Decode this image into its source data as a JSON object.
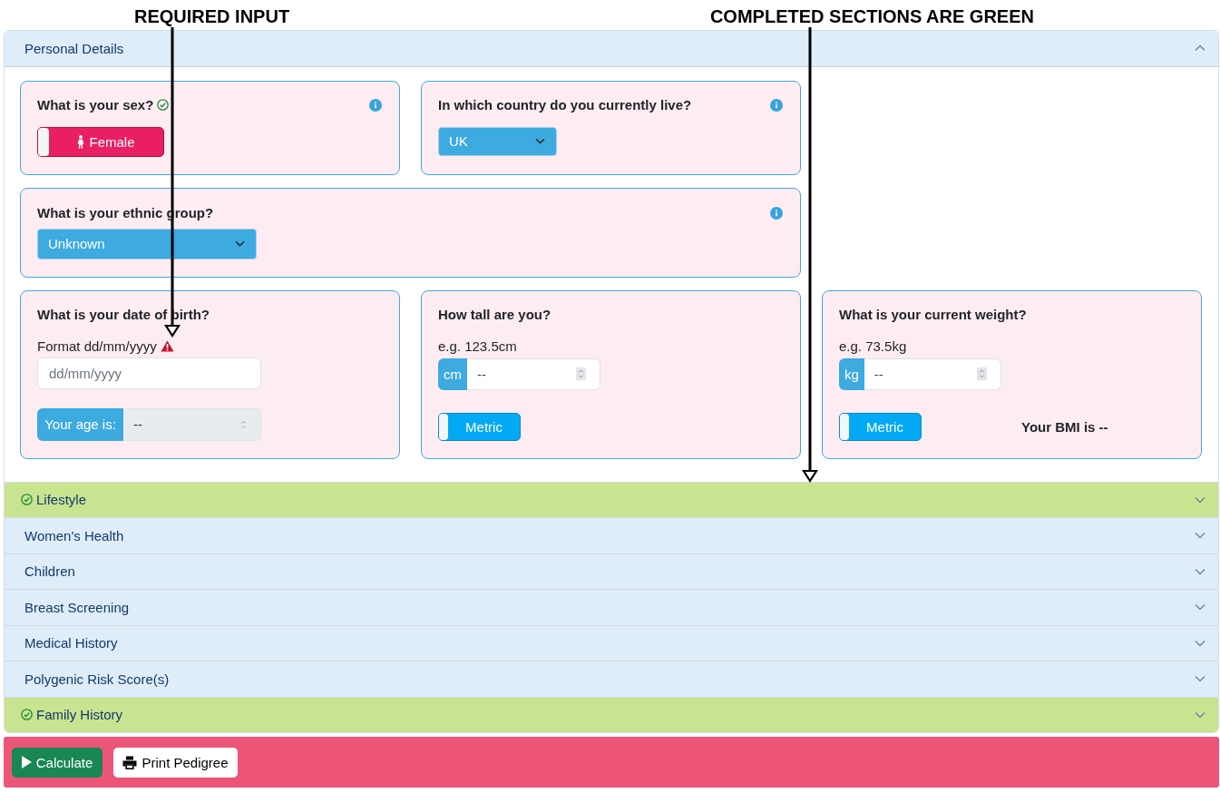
{
  "annotations": [
    {
      "text": "REQUIRED INPUT"
    },
    {
      "text": "COMPLETED SECTIONS ARE GREEN"
    }
  ],
  "sections": [
    {
      "title": "Personal Details",
      "expanded": true,
      "completed": false,
      "rows": [
        [
          {
            "kind": "sex",
            "title": "What is your sex?",
            "answered": true,
            "info": true,
            "toggle": {
              "label": "Female",
              "on": false
            }
          },
          {
            "kind": "select",
            "title": "In which country do you currently live?",
            "answered": false,
            "info": true,
            "value": "UK"
          }
        ],
        [
          {
            "kind": "select",
            "title": "What is your ethnic group?",
            "answered": false,
            "info": true,
            "value": "Unknown"
          }
        ],
        [
          {
            "kind": "date",
            "title": "What is your date of birth?",
            "answered": false,
            "info": false,
            "hint": "Format dd/mm/yyyy",
            "missing": true,
            "placeholder": "dd/mm/yyyy",
            "age_label": "Your age is:",
            "age_value": "--"
          },
          {
            "kind": "measure",
            "title": "How tall are you?",
            "answered": false,
            "info": false,
            "hint": "e.g. 123.5cm",
            "missing": false,
            "unit": "cm",
            "value": "--",
            "toggle": {
              "label": "Metric",
              "on": false
            }
          },
          {
            "kind": "measure",
            "title": "What is your current weight?",
            "answered": false,
            "info": false,
            "hint": "e.g. 73.5kg",
            "missing": false,
            "unit": "kg",
            "value": "--",
            "toggle": {
              "label": "Metric",
              "on": false
            },
            "result": "Your BMI is --"
          }
        ]
      ]
    },
    {
      "title": "Lifestyle",
      "expanded": false,
      "completed": true
    },
    {
      "title": "Women's Health",
      "expanded": false,
      "completed": false
    },
    {
      "title": "Children",
      "expanded": false,
      "completed": false
    },
    {
      "title": "Breast Screening",
      "expanded": false,
      "completed": false
    },
    {
      "title": "Medical History",
      "expanded": false,
      "completed": false
    },
    {
      "title": "Polygenic Risk Score(s)",
      "expanded": false,
      "completed": false
    },
    {
      "title": "Family History",
      "expanded": false,
      "completed": true
    }
  ],
  "footer": {
    "buttons": [
      {
        "kind": "calculate",
        "label": "Calculate"
      },
      {
        "kind": "print",
        "label": "Print Pedigree"
      }
    ]
  }
}
